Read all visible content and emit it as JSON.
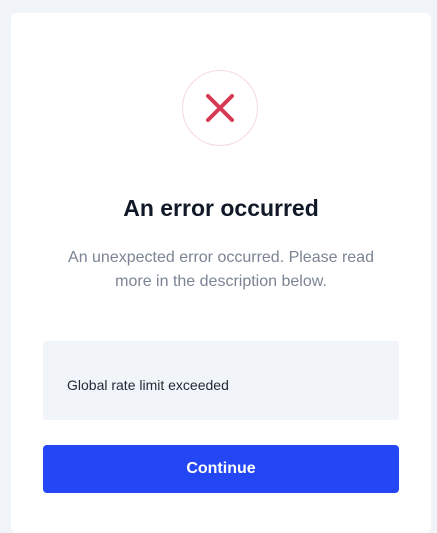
{
  "dialog": {
    "icon": "close-x-icon",
    "icon_color": "#d63a54",
    "title": "An error occurred",
    "description": "An unexpected error occurred. Please read more in the description below.",
    "error_message": "Global rate limit exceeded",
    "continue_label": "Continue",
    "accent_color": "#2447f5"
  }
}
